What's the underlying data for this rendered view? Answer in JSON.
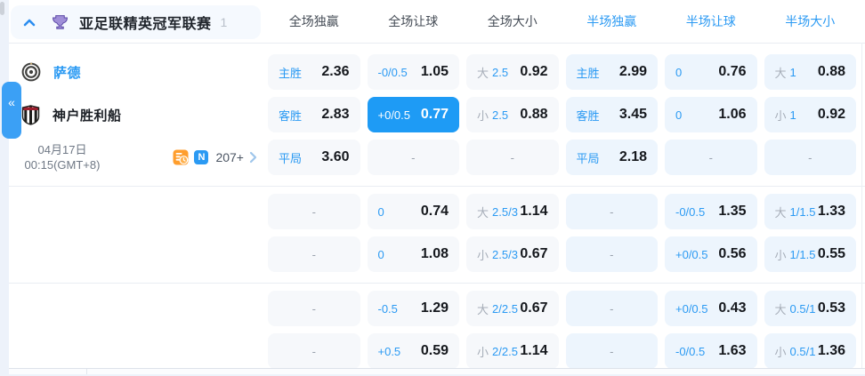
{
  "league_header": {
    "name": "亚足联精英冠军联赛",
    "match_count": "1",
    "columns": [
      {
        "key": "ft-1x2",
        "label": "全场独赢",
        "tone": "dark"
      },
      {
        "key": "ft-handicap",
        "label": "全场让球",
        "tone": "dark"
      },
      {
        "key": "ft-ou",
        "label": "全场大小",
        "tone": "dark"
      },
      {
        "key": "ht-1x2",
        "label": "半场独赢",
        "tone": "blue"
      },
      {
        "key": "ht-handicap",
        "label": "半场让球",
        "tone": "blue"
      },
      {
        "key": "ht-ou",
        "label": "半场大小",
        "tone": "blue"
      }
    ]
  },
  "match": {
    "home_team": "萨德",
    "away_team": "神户胜利船",
    "date": "04月17日",
    "time": "00:15(GMT+8)",
    "extra_markets": "207+",
    "n_badge_label": "N"
  },
  "collapse_tab_glyph": "«",
  "dash_glyph": "-",
  "icons": [
    "chevron-up-icon",
    "trophy-icon",
    "home-crest-icon",
    "away-crest-icon",
    "odds-history-icon",
    "n-badge-icon",
    "chevron-right-icon",
    "collapse-left-icon"
  ],
  "colors": {
    "accent_blue": "#2b9af3",
    "selected_cell_bg": "#1e9bf5",
    "fulltime_cell_bg": "#f6f8fb",
    "halftime_cell_bg": "#edf5fd",
    "odds_text": "#15181d",
    "muted_gray": "#a6adb8"
  },
  "rows": [
    {
      "group": 0,
      "left": "home",
      "cells": [
        {
          "type": "pick",
          "label": "主胜",
          "value": "2.36"
        },
        {
          "type": "pick",
          "label": "-0/0.5",
          "value": "1.05"
        },
        {
          "type": "ou",
          "side": "大",
          "line": "2.5",
          "value": "0.92"
        },
        {
          "type": "pick",
          "label": "主胜",
          "value": "2.99"
        },
        {
          "type": "pick",
          "label": "0",
          "value": "0.76"
        },
        {
          "type": "ou",
          "side": "大",
          "line": "1",
          "value": "0.88"
        }
      ]
    },
    {
      "group": 0,
      "left": "away",
      "cells": [
        {
          "type": "pick",
          "label": "客胜",
          "value": "2.83"
        },
        {
          "type": "pick",
          "label": "+0/0.5",
          "value": "0.77",
          "selected": true
        },
        {
          "type": "ou",
          "side": "小",
          "line": "2.5",
          "value": "0.88"
        },
        {
          "type": "pick",
          "label": "客胜",
          "value": "3.45"
        },
        {
          "type": "pick",
          "label": "0",
          "value": "1.06"
        },
        {
          "type": "ou",
          "side": "小",
          "line": "1",
          "value": "0.92"
        }
      ]
    },
    {
      "group": 0,
      "left": "info",
      "cells": [
        {
          "type": "pick",
          "label": "平局",
          "value": "3.60"
        },
        {
          "type": "dash"
        },
        {
          "type": "dash"
        },
        {
          "type": "pick",
          "label": "平局",
          "value": "2.18"
        },
        {
          "type": "dash"
        },
        {
          "type": "dash"
        }
      ]
    },
    {
      "group": 1,
      "left": "empty",
      "cells": [
        {
          "type": "dash"
        },
        {
          "type": "pick",
          "label": "0",
          "value": "0.74"
        },
        {
          "type": "ou",
          "side": "大",
          "line": "2.5/3",
          "value": "1.14"
        },
        {
          "type": "dash"
        },
        {
          "type": "pick",
          "label": "-0/0.5",
          "value": "1.35"
        },
        {
          "type": "ou",
          "side": "大",
          "line": "1/1.5",
          "value": "1.33"
        }
      ]
    },
    {
      "group": 1,
      "left": "empty",
      "cells": [
        {
          "type": "dash"
        },
        {
          "type": "pick",
          "label": "0",
          "value": "1.08"
        },
        {
          "type": "ou",
          "side": "小",
          "line": "2.5/3",
          "value": "0.67"
        },
        {
          "type": "dash"
        },
        {
          "type": "pick",
          "label": "+0/0.5",
          "value": "0.56"
        },
        {
          "type": "ou",
          "side": "小",
          "line": "1/1.5",
          "value": "0.55"
        }
      ]
    },
    {
      "group": 2,
      "left": "empty",
      "cells": [
        {
          "type": "dash"
        },
        {
          "type": "pick",
          "label": "-0.5",
          "value": "1.29"
        },
        {
          "type": "ou",
          "side": "大",
          "line": "2/2.5",
          "value": "0.67"
        },
        {
          "type": "dash"
        },
        {
          "type": "pick",
          "label": "+0/0.5",
          "value": "0.43"
        },
        {
          "type": "ou",
          "side": "大",
          "line": "0.5/1",
          "value": "0.53"
        }
      ]
    },
    {
      "group": 2,
      "left": "empty",
      "cells": [
        {
          "type": "dash"
        },
        {
          "type": "pick",
          "label": "+0.5",
          "value": "0.59"
        },
        {
          "type": "ou",
          "side": "小",
          "line": "2/2.5",
          "value": "1.14"
        },
        {
          "type": "dash"
        },
        {
          "type": "pick",
          "label": "-0/0.5",
          "value": "1.63"
        },
        {
          "type": "ou",
          "side": "小",
          "line": "0.5/1",
          "value": "1.36"
        }
      ]
    }
  ]
}
